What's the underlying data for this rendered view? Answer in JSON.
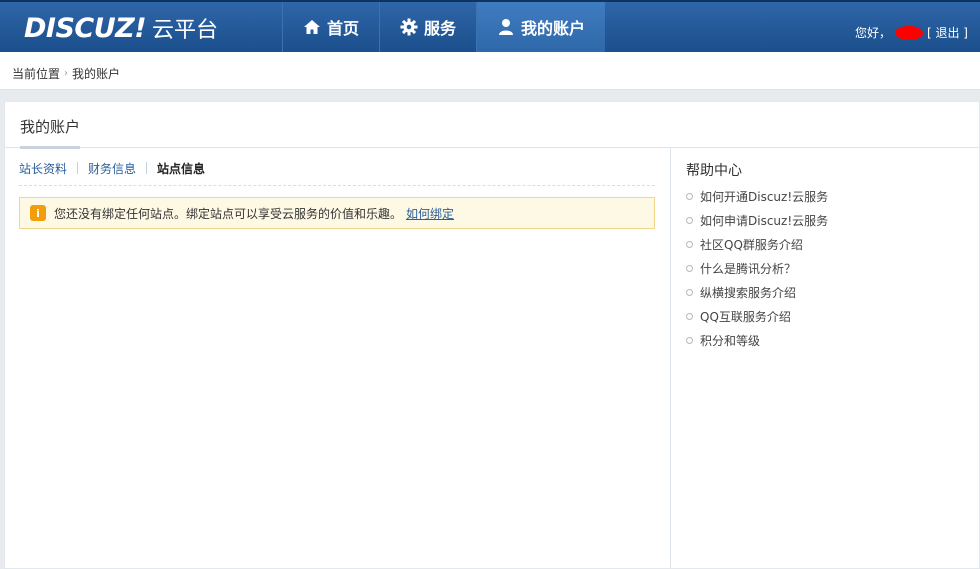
{
  "header": {
    "logo_brand": "DISCUZ!",
    "logo_sub": "云平台",
    "nav": [
      {
        "label": "首页",
        "icon": "home-icon"
      },
      {
        "label": "服务",
        "icon": "gear-icon"
      },
      {
        "label": "我的账户",
        "icon": "user-icon"
      }
    ],
    "greeting": "您好，",
    "logout": "[ 退出 ]"
  },
  "breadcrumb": {
    "current_label": "当前位置",
    "page": "我的账户"
  },
  "panel": {
    "title": "我的账户",
    "subtabs": [
      "站长资料",
      "财务信息",
      "站点信息"
    ],
    "active_subtab": "站点信息",
    "notice": {
      "icon": "info-icon",
      "text": "您还没有绑定任何站点。绑定站点可以享受云服务的价值和乐趣。",
      "link": "如何绑定"
    }
  },
  "sidebar": {
    "title": "帮助中心",
    "items": [
      "如何开通Discuz!云服务",
      "如何申请Discuz!云服务",
      "社区QQ群服务介绍",
      "什么是腾讯分析？",
      "纵横搜索服务介绍",
      "QQ互联服务介绍",
      "积分和等级"
    ]
  },
  "colors": {
    "header_bg": "#1b4f8d",
    "link": "#2a5d9a",
    "notice_bg": "#fdf9e4",
    "notice_icon": "#f39d0c"
  }
}
